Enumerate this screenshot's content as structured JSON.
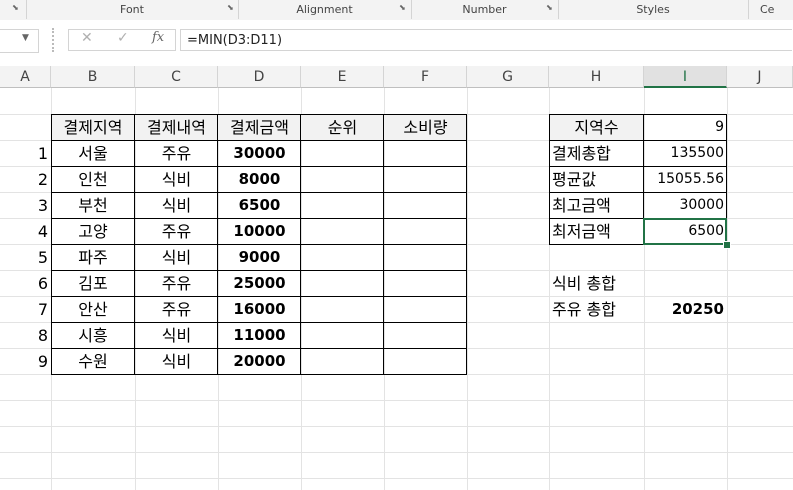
{
  "ribbon": {
    "groups": [
      "Font",
      "Alignment",
      "Number",
      "Styles",
      "Ce"
    ]
  },
  "formula_bar": {
    "cancel_icon": "✕",
    "enter_icon": "✓",
    "fx_label": "fx",
    "formula": "=MIN(D3:D11)"
  },
  "columns": [
    "A",
    "B",
    "C",
    "D",
    "E",
    "F",
    "G",
    "H",
    "I",
    "J"
  ],
  "table": {
    "headers": [
      "결제지역",
      "결제내역",
      "결제금액",
      "순위",
      "소비량"
    ],
    "row_numbers": [
      "1",
      "2",
      "3",
      "4",
      "5",
      "6",
      "7",
      "8",
      "9"
    ],
    "regions": [
      "서울",
      "인천",
      "부천",
      "고양",
      "파주",
      "김포",
      "안산",
      "시흥",
      "수원"
    ],
    "types": [
      "주유",
      "식비",
      "식비",
      "주유",
      "식비",
      "주유",
      "주유",
      "식비",
      "식비"
    ],
    "amounts": [
      "30000",
      "8000",
      "6500",
      "10000",
      "9000",
      "25000",
      "16000",
      "11000",
      "20000"
    ]
  },
  "summary": {
    "labels": [
      "지역수",
      "결제총합",
      "평균값",
      "최고금액",
      "최저금액"
    ],
    "values": [
      "9",
      "135500",
      "15055.56",
      "30000",
      "6500"
    ]
  },
  "extra": {
    "food_label": "식비 총합",
    "fuel_label": "주유 총합",
    "fuel_value": "20250"
  },
  "colors": {
    "accent": "#217346"
  }
}
